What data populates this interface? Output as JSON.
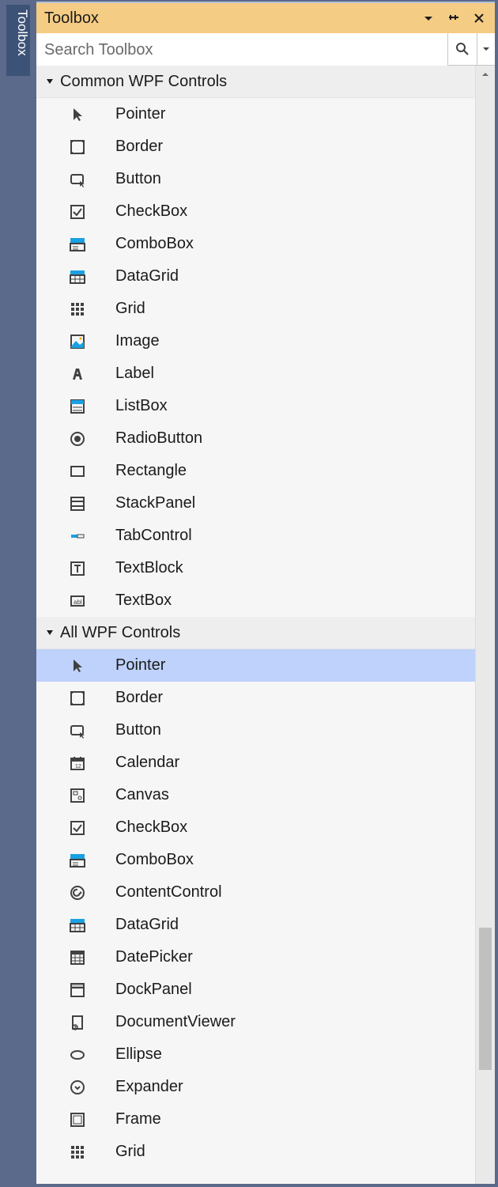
{
  "tab_label": "Toolbox",
  "window": {
    "title": "Toolbox"
  },
  "search": {
    "placeholder": "Search Toolbox"
  },
  "groups": [
    {
      "header": "Common WPF Controls",
      "expanded": true,
      "items": [
        {
          "label": "Pointer",
          "icon": "pointer"
        },
        {
          "label": "Border",
          "icon": "border"
        },
        {
          "label": "Button",
          "icon": "button"
        },
        {
          "label": "CheckBox",
          "icon": "checkbox"
        },
        {
          "label": "ComboBox",
          "icon": "combobox"
        },
        {
          "label": "DataGrid",
          "icon": "datagrid"
        },
        {
          "label": "Grid",
          "icon": "grid"
        },
        {
          "label": "Image",
          "icon": "image"
        },
        {
          "label": "Label",
          "icon": "label"
        },
        {
          "label": "ListBox",
          "icon": "listbox"
        },
        {
          "label": "RadioButton",
          "icon": "radiobutton"
        },
        {
          "label": "Rectangle",
          "icon": "rectangle"
        },
        {
          "label": "StackPanel",
          "icon": "stackpanel"
        },
        {
          "label": "TabControl",
          "icon": "tabcontrol"
        },
        {
          "label": "TextBlock",
          "icon": "textblock"
        },
        {
          "label": "TextBox",
          "icon": "textbox"
        }
      ]
    },
    {
      "header": "All WPF Controls",
      "expanded": true,
      "items": [
        {
          "label": "Pointer",
          "icon": "pointer",
          "selected": true
        },
        {
          "label": "Border",
          "icon": "border"
        },
        {
          "label": "Button",
          "icon": "button"
        },
        {
          "label": "Calendar",
          "icon": "calendar"
        },
        {
          "label": "Canvas",
          "icon": "canvas"
        },
        {
          "label": "CheckBox",
          "icon": "checkbox"
        },
        {
          "label": "ComboBox",
          "icon": "combobox"
        },
        {
          "label": "ContentControl",
          "icon": "contentcontrol"
        },
        {
          "label": "DataGrid",
          "icon": "datagrid"
        },
        {
          "label": "DatePicker",
          "icon": "datepicker"
        },
        {
          "label": "DockPanel",
          "icon": "dockpanel"
        },
        {
          "label": "DocumentViewer",
          "icon": "documentviewer"
        },
        {
          "label": "Ellipse",
          "icon": "ellipse"
        },
        {
          "label": "Expander",
          "icon": "expander"
        },
        {
          "label": "Frame",
          "icon": "frame"
        },
        {
          "label": "Grid",
          "icon": "grid"
        }
      ]
    }
  ]
}
